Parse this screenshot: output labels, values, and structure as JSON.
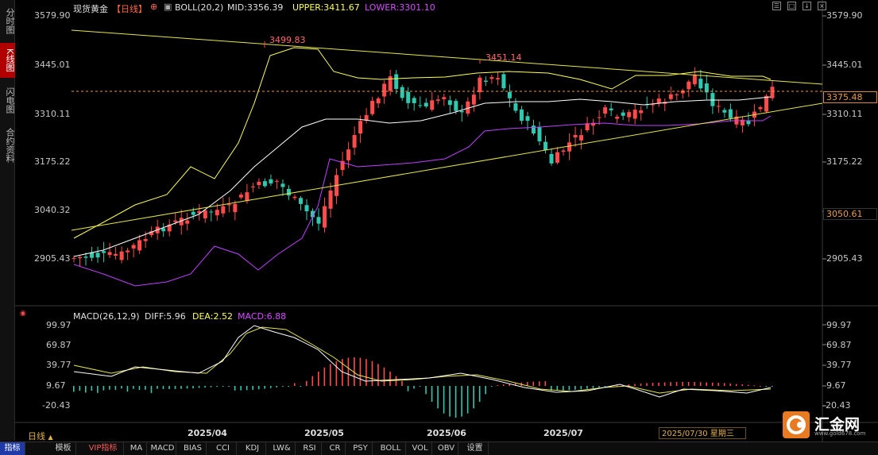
{
  "left_tabs": [
    {
      "label": "分时图",
      "active": false
    },
    {
      "label": "K线图",
      "active": true
    },
    {
      "label": "闪电图",
      "active": false
    },
    {
      "label": "合约资料",
      "active": false
    }
  ],
  "header": {
    "instrument": "现货黄金",
    "period": "【日线】",
    "boll_label": "BOLL(20,2)",
    "mid_label": "MID:3356.39",
    "upper_label": "UPPER:3411.67",
    "lower_label": "LOWER:3301.10"
  },
  "top_icons": [
    "☰",
    "□",
    "↓",
    "×"
  ],
  "price_axis": {
    "ticks": [
      "3579.90",
      "3445.01",
      "3310.11",
      "3175.22",
      "3040.32",
      "2905.43"
    ],
    "current_price": "3375.48",
    "marker_price": "3050.61",
    "high_label": "3499.83",
    "secondary_high_label": "3451.14"
  },
  "macd": {
    "label": "MACD(26,12,9)",
    "diff_label": "DIFF:5.96",
    "dea_label": "DEA:2.52",
    "macd_label": "MACD:6.88",
    "ticks": [
      "99.97",
      "69.87",
      "39.77",
      "9.67",
      "-20.43"
    ]
  },
  "x_axis": {
    "labels": [
      "2025/04",
      "2025/05",
      "2025/06",
      "2025/07"
    ]
  },
  "status": {
    "period": "日线",
    "date": "2025/07/30 星期三"
  },
  "bottom_bar": [
    {
      "label": "指标",
      "style": "active"
    },
    {
      "label": "模板",
      "style": ""
    },
    {
      "label": "VIP指标",
      "style": "vip"
    },
    {
      "label": "MA",
      "style": ""
    },
    {
      "label": "MACD",
      "style": ""
    },
    {
      "label": "BIAS",
      "style": ""
    },
    {
      "label": "CCI",
      "style": ""
    },
    {
      "label": "KDJ",
      "style": ""
    },
    {
      "label": "LW&",
      "style": ""
    },
    {
      "label": "RSI",
      "style": ""
    },
    {
      "label": "CR",
      "style": ""
    },
    {
      "label": "PSY",
      "style": ""
    },
    {
      "label": "BOLL",
      "style": ""
    },
    {
      "label": "VOL",
      "style": ""
    },
    {
      "label": "OBV",
      "style": ""
    },
    {
      "label": "设置",
      "style": ""
    }
  ],
  "logo": {
    "text": "汇金网",
    "url": "www.gold678.com"
  },
  "colors": {
    "up": "#ff4b4b",
    "down": "#2fc9b0",
    "boll_mid": "#ffffff",
    "boll_upper": "#ffff55",
    "boll_lower": "#c040ff",
    "trendline": "#e6e64a",
    "dea": "#e6e64a",
    "accent": "#e89b4b"
  }
}
